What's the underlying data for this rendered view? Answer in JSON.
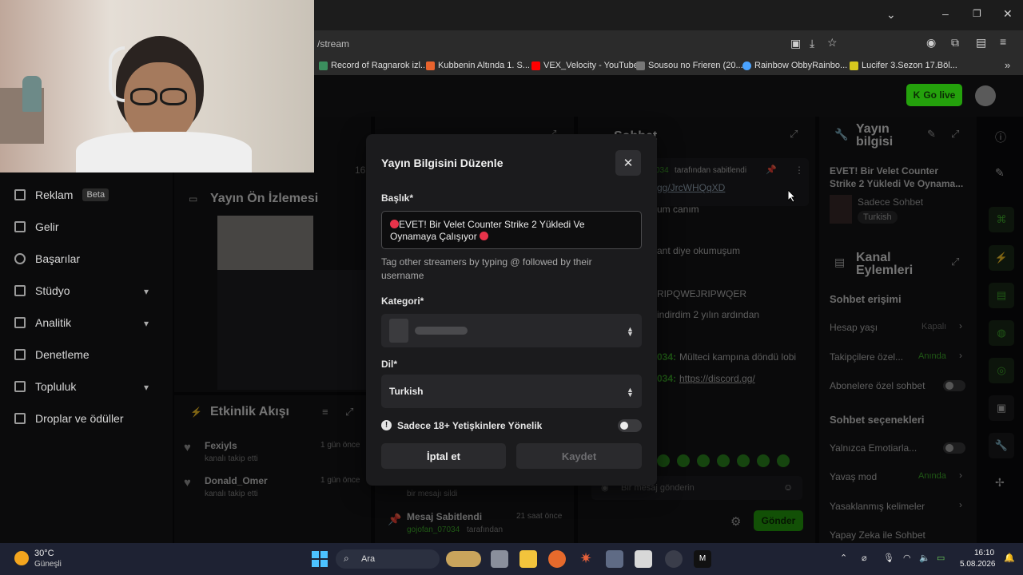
{
  "browser": {
    "url": "/stream",
    "bookmarks": [
      "Record of Ragnarok izl...",
      "Kubbenin Altında 1. S...",
      "VEX_Velocity - YouTube",
      "Sousou no Frieren (20...",
      "Rainbow ObbyRainbo...",
      "Lucifer 3.Sezon 17.Böl..."
    ]
  },
  "header": {
    "go_live": "Go live"
  },
  "sidebar": {
    "items": [
      {
        "label": "Reklam",
        "badge": "Beta"
      },
      {
        "label": "Gelir"
      },
      {
        "label": "Başarılar"
      },
      {
        "label": "Stüdyo"
      },
      {
        "label": "Analitik"
      },
      {
        "label": "Denetleme"
      },
      {
        "label": "Topluluk"
      },
      {
        "label": "Droplar ve ödüller"
      }
    ]
  },
  "preview": {
    "title": "Yayın Ön İzlemesi",
    "count": "16"
  },
  "activity": {
    "title": "Etkinlik Akışı",
    "items": [
      {
        "user": "Fexiyls",
        "desc": "kanalı takip etti",
        "time": "1 gün önce"
      },
      {
        "user": "Donald_Omer",
        "desc": "kanalı takip etti",
        "time": "1 gün önce"
      }
    ]
  },
  "pinned": {
    "title": "Mesaj Sabitlendi",
    "by": "gojofan_07034",
    "by_suffix": "tarafından",
    "time": "21 saat önce",
    "deleted": "bir mesajı sildi"
  },
  "chat": {
    "title": "Sohbet",
    "pinned_by": "tarafından sabitlendi",
    "pinned_link": "gg/JrcWHQqXD",
    "pinned_user": "034",
    "lines": [
      "um canım",
      "ant diye okumuşum",
      "RIPQWEJRIPWQER",
      "indirdim 2 yılın ardından"
    ],
    "msg1_user": "034:",
    "msg1_text": "Mülteci kampına döndü lobi",
    "msg2_user": "034:",
    "msg2_link": "https://discord.gg/",
    "placeholder": "Bir mesaj gönderin",
    "send": "Gönder"
  },
  "stream_info": {
    "title": "Yayın bilgisi",
    "stream_title": "EVET! Bir Velet Counter Strike 2 Yükledi Ve Oynama...",
    "mode": "Sadece Sohbet",
    "lang": "Turkish"
  },
  "channel_actions": {
    "title": "Kanal Eylemleri",
    "chat_access": "Sohbet erişimi",
    "account_age": "Hesap yaşı",
    "account_age_val": "Kapalı",
    "followers": "Takipçilere özel...",
    "followers_val": "Anında",
    "subscribers": "Abonelere özel sohbet",
    "chat_options": "Sohbet seçenekleri",
    "emotes": "Yalnızca Emotiarla...",
    "slow": "Yavaş mod",
    "slow_val": "Anında",
    "banned_words": "Yasaklanmış kelimeler",
    "ai_chat": "Yapay Zeka ile Sohbet"
  },
  "modal": {
    "title": "Yayın Bilgisini Düzenle",
    "title_label": "Başlık*",
    "title_value": "EVET! Bir Velet Counter Strike 2 Yükledi Ve Oynamaya Çalışıyor",
    "tag_hint": "Tag other streamers by typing @ followed by their username",
    "category_label": "Kategori*",
    "language_label": "Dil*",
    "language_value": "Turkish",
    "adult_label": "Sadece 18+ Yetişkinlere Yönelik",
    "cancel": "İptal et",
    "save": "Kaydet"
  },
  "taskbar": {
    "temp": "30°C",
    "weather": "Güneşli",
    "search": "Ara",
    "time": "16:10",
    "date": "5.08.2026"
  },
  "colors": {
    "accent": "#24a10c",
    "danger": "#e8334a"
  }
}
